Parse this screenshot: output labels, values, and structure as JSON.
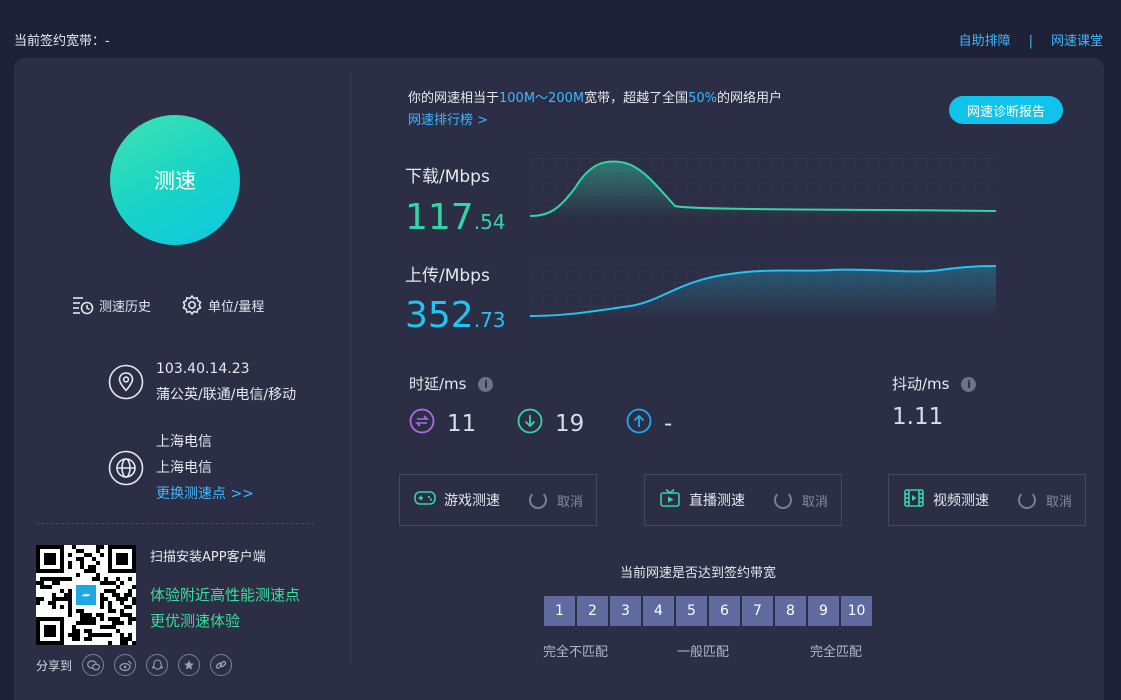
{
  "header": {
    "contract_bandwidth": "当前签约宽带：-",
    "links": [
      "自助排障",
      "网速课堂"
    ],
    "separator": "|"
  },
  "left": {
    "speed_button": "测速",
    "tools": [
      {
        "label": "测速历史",
        "icon": "history-icon"
      },
      {
        "label": "单位/量程",
        "icon": "gear-icon"
      }
    ],
    "ip": {
      "address": "103.40.14.23",
      "isp": "蒲公英/联通/电信/移动",
      "icon": "location-pin-icon"
    },
    "server": {
      "line1": "上海电信",
      "line2": "上海电信",
      "change_link": "更换测速点 >>",
      "icon": "globe-icon"
    },
    "qr": {
      "title": "扫描安装APP客户端",
      "line1": "体验附近高性能测速点",
      "line2": "更优测速体验"
    },
    "share": {
      "label": "分享到",
      "icons": [
        "wechat-icon",
        "weibo-icon",
        "qq-icon",
        "favorite-star-icon",
        "link-icon"
      ]
    }
  },
  "right": {
    "summary": {
      "prefix": "你的网速相当于",
      "band": "100M～200M",
      "middle": "宽带，超越了全国",
      "percent": "50%",
      "suffix": "的网络用户",
      "ranking_link": "网速排行榜 >"
    },
    "report_button": "网速诊断报告",
    "download": {
      "label": "下载/Mbps",
      "int": "117",
      "dec": ".54",
      "color": "#35d4a6"
    },
    "upload": {
      "label": "上传/Mbps",
      "int": "352",
      "dec": ".73",
      "color": "#22c5ef"
    },
    "latency": {
      "label": "时延/ms",
      "values": [
        "11",
        "19",
        "-"
      ],
      "icons": [
        "ping-icon",
        "download-arrow-icon",
        "upload-arrow-icon"
      ]
    },
    "jitter": {
      "label": "抖动/ms",
      "value": "1.11"
    },
    "tests": [
      {
        "name": "游戏测速",
        "cancel": "取消",
        "icon": "gamepad-icon"
      },
      {
        "name": "直播测速",
        "cancel": "取消",
        "icon": "tv-icon"
      },
      {
        "name": "视频测速",
        "cancel": "取消",
        "icon": "film-icon"
      }
    ],
    "match": {
      "title": "当前网速是否达到签约带宽",
      "scale": [
        "1",
        "2",
        "3",
        "4",
        "5",
        "6",
        "7",
        "8",
        "9",
        "10"
      ],
      "labels": [
        "完全不匹配",
        "一般匹配",
        "完全匹配"
      ]
    }
  }
}
